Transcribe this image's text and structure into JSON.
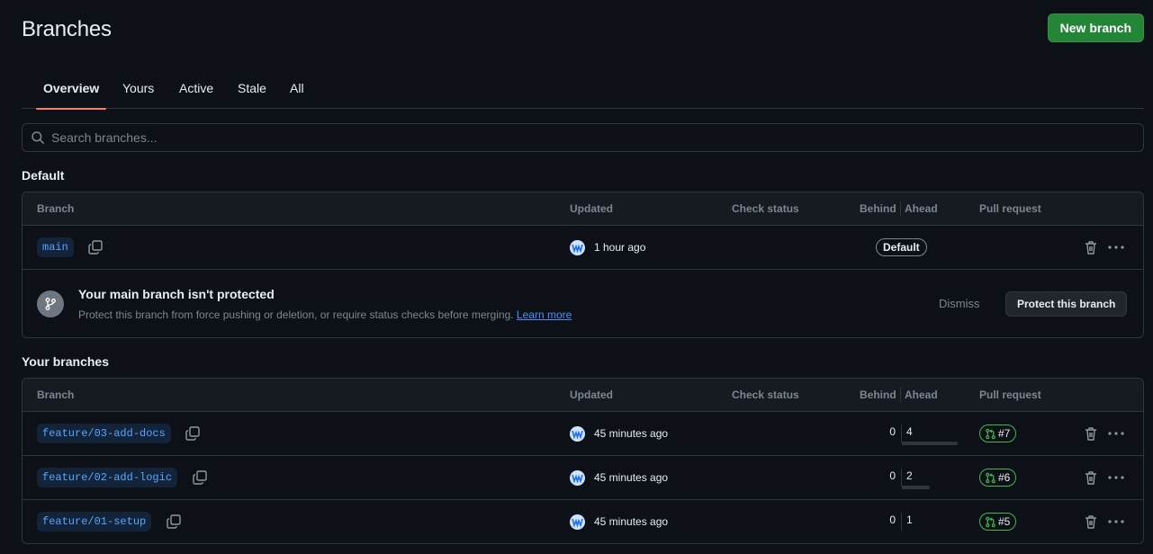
{
  "header": {
    "title": "Branches",
    "new_branch_label": "New branch"
  },
  "tabs": [
    {
      "label": "Overview",
      "active": true
    },
    {
      "label": "Yours",
      "active": false
    },
    {
      "label": "Active",
      "active": false
    },
    {
      "label": "Stale",
      "active": false
    },
    {
      "label": "All",
      "active": false
    }
  ],
  "search": {
    "placeholder": "Search branches...",
    "value": ""
  },
  "columns": {
    "branch": "Branch",
    "updated": "Updated",
    "check_status": "Check status",
    "behind": "Behind",
    "ahead": "Ahead",
    "pull_request": "Pull request"
  },
  "default_section": {
    "title": "Default",
    "branch": {
      "name": "main",
      "updated": "1 hour ago",
      "badge": "Default"
    },
    "notice": {
      "title": "Your main branch isn't protected",
      "text": "Protect this branch from force pushing or deletion, or require status checks before merging.",
      "link": "Learn more",
      "dismiss_label": "Dismiss",
      "protect_label": "Protect this branch"
    }
  },
  "your_branches": {
    "title": "Your branches",
    "rows": [
      {
        "name": "feature/03-add-docs",
        "updated": "45 minutes ago",
        "behind": "0",
        "ahead": "4",
        "pr": "#7"
      },
      {
        "name": "feature/02-add-logic",
        "updated": "45 minutes ago",
        "behind": "0",
        "ahead": "2",
        "pr": "#6"
      },
      {
        "name": "feature/01-setup",
        "updated": "45 minutes ago",
        "behind": "0",
        "ahead": "1",
        "pr": "#5"
      }
    ]
  },
  "colors": {
    "accent_green": "#238636",
    "tab_underline": "#f78166",
    "branch_blue": "#58a6ff",
    "pr_open": "#3fb950",
    "link": "#4493f8"
  },
  "icons": {
    "search": "search-icon",
    "copy": "copy-icon",
    "trash": "trash-icon",
    "more": "kebab-horizontal-icon",
    "branch": "git-branch-icon",
    "pull_request": "git-pull-request-icon",
    "avatar": "user-avatar"
  }
}
